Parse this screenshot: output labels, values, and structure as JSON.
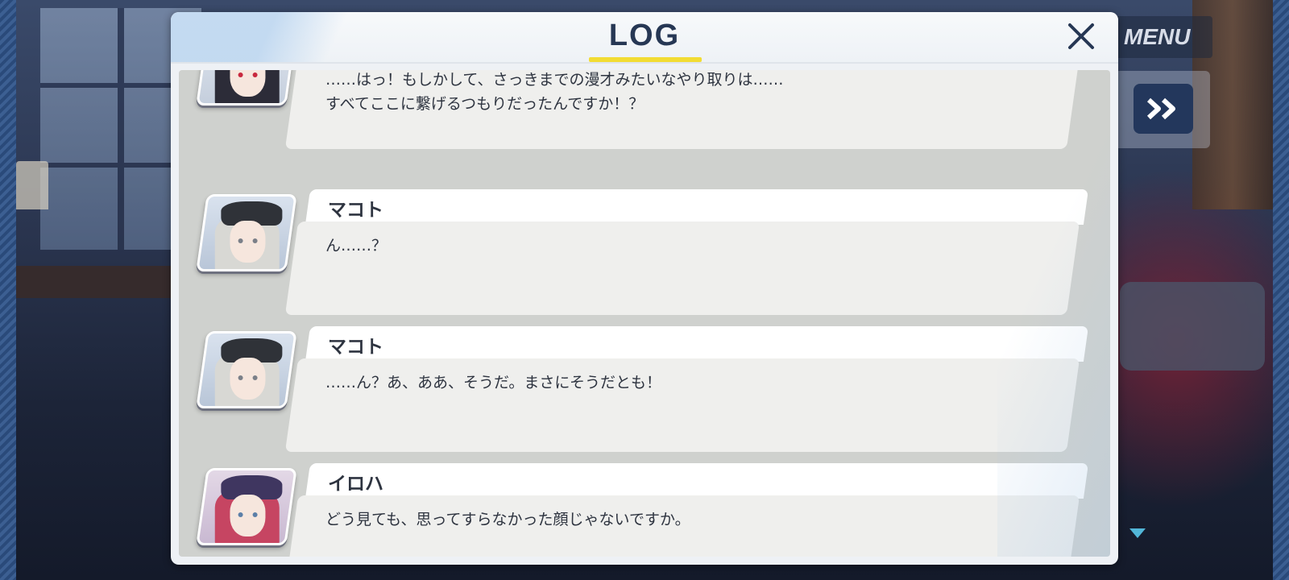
{
  "hud": {
    "menu_label": "MENU"
  },
  "log": {
    "title": "LOG",
    "entries": [
      {
        "speaker": "",
        "line1": "……はっ！もしかして、さっきまでの漫才みたいなやり取りは……",
        "line2": "すべてここに繋げるつもりだったんですか！？",
        "portrait": "iori"
      },
      {
        "speaker": "マコト",
        "line1": "ん……？",
        "line2": "",
        "portrait": "makoto"
      },
      {
        "speaker": "マコト",
        "line1": "……ん？あ、ああ、そうだ。まさにそうだとも！",
        "line2": "",
        "portrait": "makoto"
      },
      {
        "speaker": "イロハ",
        "line1": "どう見ても、思ってすらなかった顔じゃないですか。",
        "line2": "",
        "portrait": "iroha"
      }
    ]
  },
  "colors": {
    "title_text": "#263754",
    "title_underline": "#f2dc33",
    "button_navy": "#23375c",
    "indicator": "#52b6d8"
  },
  "icons": {
    "close": "close-icon",
    "skip": "fast-forward-icon",
    "next": "triangle-down-icon"
  }
}
